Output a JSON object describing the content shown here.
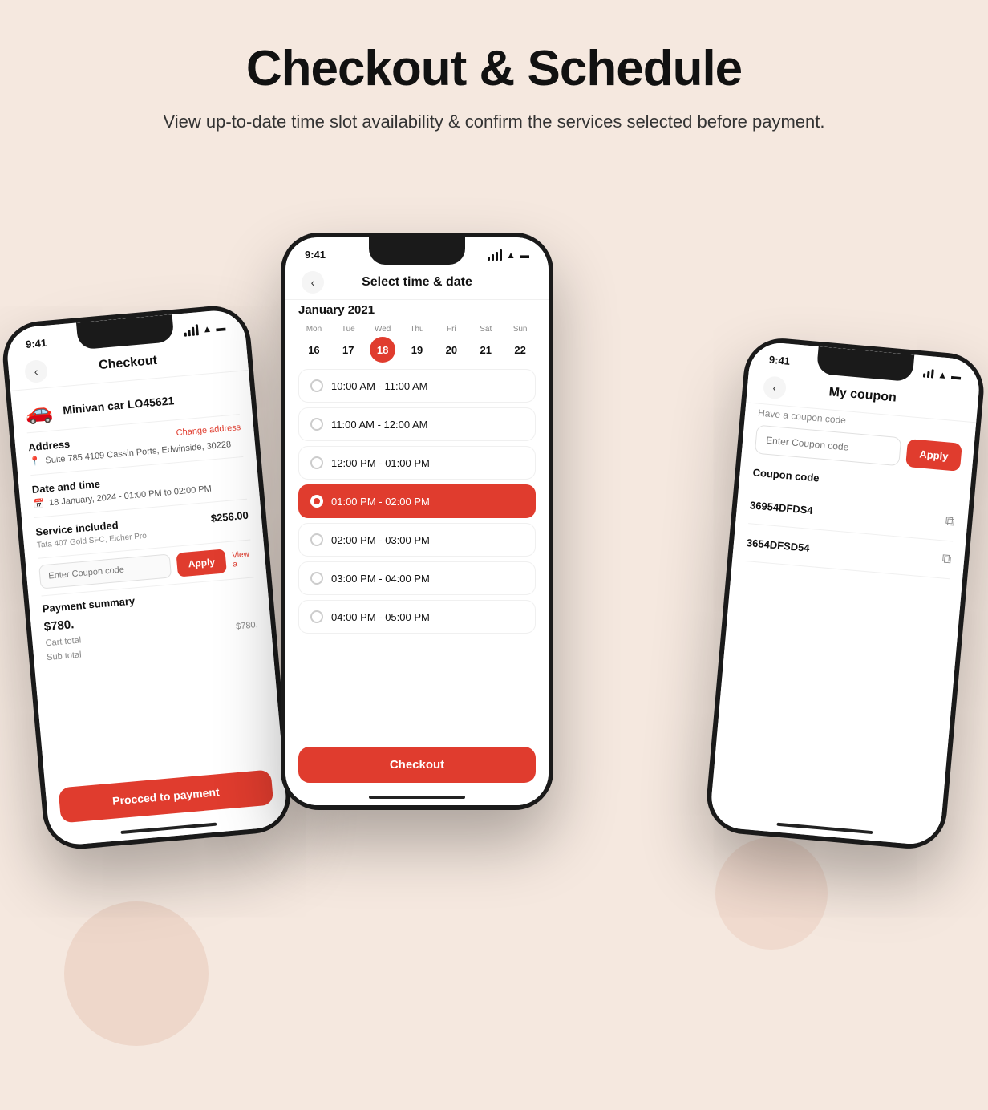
{
  "page": {
    "title": "Checkout & Schedule",
    "subtitle": "View up-to-date time slot availability & confirm the\nservices selected before payment."
  },
  "phone1": {
    "status_time": "9:41",
    "title": "Checkout",
    "car_emoji": "🚗",
    "car_name": "Minivan car LO45621",
    "address_label": "Address",
    "change_link": "Change address",
    "address_value": "Suite 785 4109 Cassin Ports, Edwinside, 30228",
    "date_label": "Date and time",
    "date_value": "18 January, 2024 - 01:00 PM to 02:00 PM",
    "service_label": "Service included",
    "service_price": "$256.00",
    "service_subtitle": "Tata 407 Gold SFC, Eicher Pro",
    "coupon_placeholder": "Enter Coupon code",
    "apply_label": "Apply",
    "view_link": "View a",
    "payment_title": "Payment summary",
    "big_price": "$780.",
    "cart_label": "Cart total",
    "cart_value": "$780.",
    "sub_label": "Sub total",
    "proceed_label": "Procced to payment"
  },
  "phone2": {
    "status_time": "9:41",
    "title": "Select time & date",
    "month": "January 2021",
    "days": [
      {
        "name": "Mon",
        "num": "16"
      },
      {
        "name": "Tue",
        "num": "17"
      },
      {
        "name": "Wed",
        "num": "18",
        "selected": true
      },
      {
        "name": "Thu",
        "num": "19"
      },
      {
        "name": "Fri",
        "num": "20"
      },
      {
        "name": "Sat",
        "num": "21"
      },
      {
        "name": "Sun",
        "num": "22"
      }
    ],
    "slots": [
      {
        "time": "10:00 AM - 11:00 AM",
        "active": false
      },
      {
        "time": "11:00 AM - 12:00 AM",
        "active": false
      },
      {
        "time": "12:00 PM - 01:00 PM",
        "active": false
      },
      {
        "time": "01:00 PM - 02:00 PM",
        "active": true
      },
      {
        "time": "02:00 PM - 03:00 PM",
        "active": false
      },
      {
        "time": "03:00 PM - 04:00 PM",
        "active": false
      },
      {
        "time": "04:00 PM - 05:00 PM",
        "active": false
      }
    ],
    "checkout_btn": "Checkout"
  },
  "phone3": {
    "status_time": "9:41",
    "title": "My coupon",
    "coupon_prompt": "Have a coupon code",
    "coupon_placeholder": "Enter Coupon code",
    "apply_label": "Apply",
    "coupon_list_label": "Coupon code",
    "coupons": [
      {
        "code": "36954DFDS4"
      },
      {
        "code": "3654DFSD54"
      }
    ]
  }
}
